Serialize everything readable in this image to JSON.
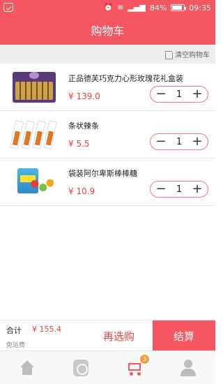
{
  "status_bar": {
    "battery": "84%",
    "time": "09:35"
  },
  "title": "购物车",
  "clear_cart_label": "清空购物车",
  "items": [
    {
      "name": "正品德芙巧克力心形玫瑰花礼盒装",
      "price": "¥ 139.0",
      "qty": "1",
      "thumb_icon": "chocolate-gift-box"
    },
    {
      "name": "条状辣条",
      "price": "¥ 5.5",
      "qty": "1",
      "thumb_icon": "spicy-strips"
    },
    {
      "name": "袋装阿尔卑斯棒棒糖",
      "price": "¥ 10.9",
      "qty": "1",
      "thumb_icon": "lollipop-bag"
    }
  ],
  "checkout": {
    "total_label": "合计",
    "total_value": "¥ 155.4",
    "shipping": "免运费",
    "reselect_label": "再选购",
    "pay_label": "结算"
  },
  "tabbar": {
    "cart_badge": "3",
    "active_tab": "cart"
  },
  "colors": {
    "primary": "#f5565f",
    "price": "#e8413f",
    "badge": "#f0a043"
  }
}
